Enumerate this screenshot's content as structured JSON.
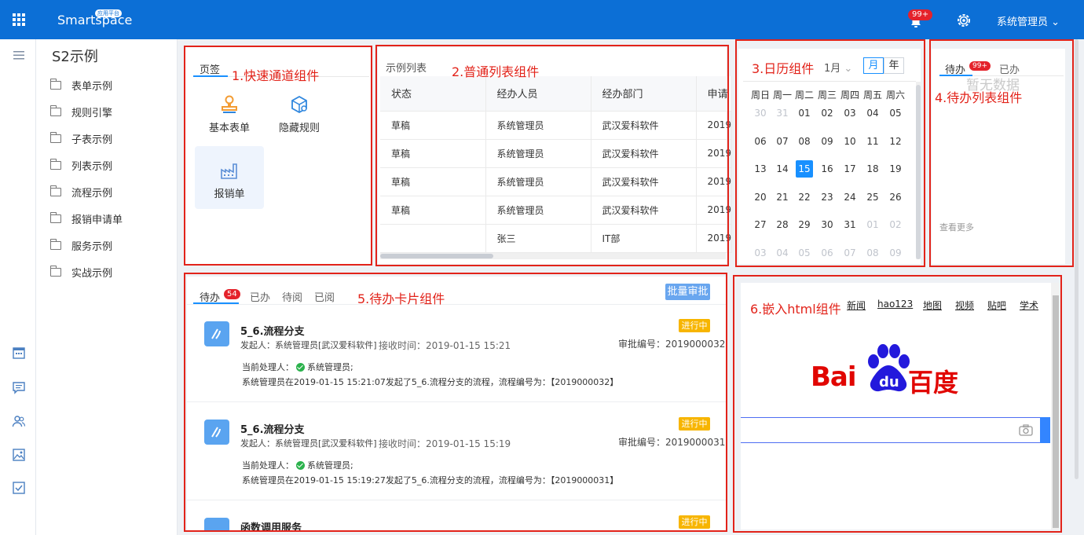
{
  "topbar": {
    "logo": "Smartspace",
    "logo_badge": "应用平台",
    "notif_count": "99+",
    "user": "系统管理员"
  },
  "sidebar": {
    "title": "S2示例",
    "items": [
      "表单示例",
      "规则引擎",
      "子表示例",
      "列表示例",
      "流程示例",
      "报销申请单",
      "服务示例",
      "实战示例"
    ]
  },
  "widgets": {
    "quick": {
      "label": "1.快速通道组件",
      "tab": "页签",
      "items": [
        "基本表单",
        "隐藏规则",
        "报销单"
      ]
    },
    "list": {
      "label": "2.普通列表组件",
      "title": "示例列表",
      "columns": [
        "状态",
        "经办人员",
        "经办部门",
        "申请"
      ],
      "rows": [
        [
          "草稿",
          "系统管理员",
          "武汉爱科软件",
          "2019"
        ],
        [
          "草稿",
          "系统管理员",
          "武汉爱科软件",
          "2019"
        ],
        [
          "草稿",
          "系统管理员",
          "武汉爱科软件",
          "2019"
        ],
        [
          "草稿",
          "系统管理员",
          "武汉爱科软件",
          "2019"
        ],
        [
          "",
          "张三",
          "IT部",
          "2019"
        ]
      ]
    },
    "calendar": {
      "label": "3.日历组件",
      "month": "1月",
      "views": [
        "月",
        "年"
      ],
      "weekdays": [
        "周日",
        "周一",
        "周二",
        "周三",
        "周四",
        "周五",
        "周六"
      ],
      "days": [
        "30",
        "31",
        "01",
        "02",
        "03",
        "04",
        "05",
        "06",
        "07",
        "08",
        "09",
        "10",
        "11",
        "12",
        "13",
        "14",
        "15",
        "16",
        "17",
        "18",
        "19",
        "20",
        "21",
        "22",
        "23",
        "24",
        "25",
        "26",
        "27",
        "28",
        "29",
        "30",
        "31",
        "01",
        "02",
        "03",
        "04",
        "05",
        "06",
        "07",
        "08",
        "09"
      ],
      "today_index": 16
    },
    "todo": {
      "label": "4.待办列表组件",
      "tab_pending": "待办",
      "pending_count": "99+",
      "tab_done": "已办",
      "empty": "暂无数据",
      "more": "查看更多"
    },
    "cards": {
      "label": "5.待办卡片组件",
      "tabs": [
        "待办",
        "已办",
        "待阅",
        "已阅"
      ],
      "pending_count": "54",
      "batch": "批量审批",
      "items": [
        {
          "title": "5_6.流程分支",
          "initiator": "发起人：系统管理员[武汉爱科软件]",
          "received": "接收时间：2019-01-15 15:21",
          "no": "审批编号：2019000032",
          "status": "进行中",
          "handler_label": "当前处理人：",
          "handler": "系统管理员;",
          "desc": "系统管理员在2019-01-15 15:21:07发起了5_6.流程分支的流程，流程编号为：【2019000032】"
        },
        {
          "title": "5_6.流程分支",
          "initiator": "发起人：系统管理员[武汉爱科软件]",
          "received": "接收时间：2019-01-15 15:19",
          "no": "审批编号：2019000031",
          "status": "进行中",
          "handler_label": "当前处理人：",
          "handler": "系统管理员;",
          "desc": "系统管理员在2019-01-15 15:19:27发起了5_6.流程分支的流程，流程编号为：【2019000031】"
        },
        {
          "title": "函数调用服务",
          "status": "进行中"
        }
      ]
    },
    "html": {
      "label": "6.嵌入html组件",
      "links": [
        "新闻",
        "hao123",
        "地图",
        "视频",
        "贴吧",
        "学术"
      ],
      "logo_left": "Bai",
      "logo_du": "du",
      "logo_right": "百度"
    }
  },
  "colors": {
    "primary": "#0c6fd6",
    "accent": "#1890ff",
    "annotation": "#e2231a",
    "status": "#f7b500"
  }
}
